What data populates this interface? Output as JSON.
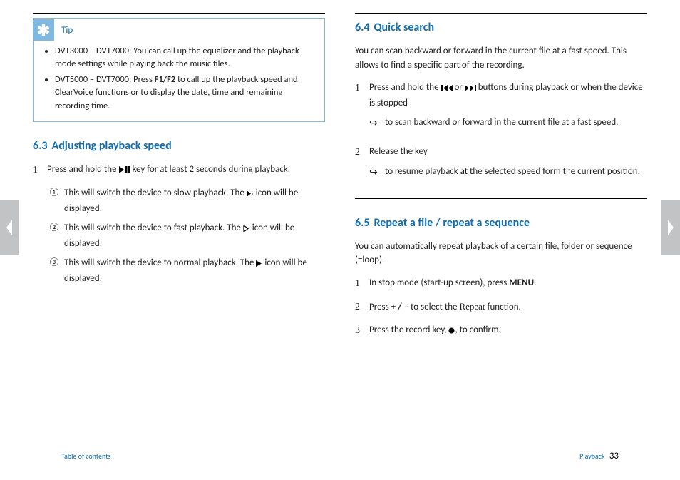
{
  "nav": {
    "prev": "Previous page",
    "next": "Next page"
  },
  "left": {
    "tip": {
      "label": "Tip",
      "item1_a": "DVT3000 – DVT7000: You can call up the equalizer and the playback mode settings while playing back the music files.",
      "item2_a": "DVT5000 – DVT7000: Press ",
      "item2_bold": "F1/F2",
      "item2_b": " to call up the playback speed and ClearVoice functions or to display the date, time and remaining recording time."
    },
    "s63": {
      "num": "6.3",
      "title": "Adjusting playback speed",
      "step1_a": "Press and hold the ",
      "step1_b": " key for at least 2 seconds during playback.",
      "sub1_a": "This will switch the device to slow playback. The ",
      "sub1_b": " icon will be displayed.",
      "sub2_a": "This will switch the device to fast playback. The ",
      "sub2_b": " icon will be displayed.",
      "sub3_a": "This will switch the device to normal playback. The ",
      "sub3_b": " icon will be displayed."
    }
  },
  "right": {
    "s64": {
      "num": "6.4",
      "title": "Quick search",
      "intro": "You can scan backward or forward in the current file at a fast speed. This allows to find a specific part of the recording.",
      "step1_a": "Press and hold the ",
      "step1_b": " or ",
      "step1_c": " buttons during playback or when the device is stopped",
      "step1_res": "to scan backward or forward in the current file at a fast speed.",
      "step2_a": "Release the key",
      "step2_res": "to resume playback at the selected speed form the current position."
    },
    "s65": {
      "num": "6.5",
      "title": "Repeat a file / repeat a sequence",
      "intro": "You can automatically repeat playback of a certain file, folder or sequence (=loop).",
      "step1_a": "In stop mode (start-up screen), press ",
      "step1_bold": "MENU",
      "step1_b": ".",
      "step2_a": "Press ",
      "step2_bold": "+ / –",
      "step2_b": " to select the ",
      "step2_fn": "Repeat",
      "step2_c": " function.",
      "step3_a": "Press the record key, ",
      "step3_b": ", to confirm."
    }
  },
  "footer": {
    "toc": "Table of contents",
    "section": "Playback",
    "page": "33"
  }
}
